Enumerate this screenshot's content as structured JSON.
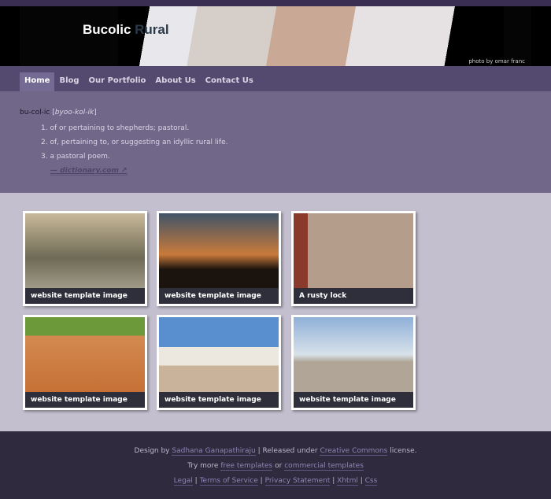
{
  "header": {
    "title_a": "Bucolic",
    "title_b": "Rural",
    "credit": "photo by omar franc"
  },
  "nav": [
    {
      "label": "Home",
      "active": true
    },
    {
      "label": "Blog"
    },
    {
      "label": "Our Portfolio"
    },
    {
      "label": "About Us"
    },
    {
      "label": "Contact Us"
    }
  ],
  "definition": {
    "word": "bu-col-ic",
    "pron": "byoo-kol-ik",
    "senses": [
      "1. of or pertaining to shepherds; pastoral.",
      "2. of, pertaining to, or suggesting an idyllic rural life.",
      "3. a pastoral poem."
    ],
    "source": "— dictionary.com",
    "source_icon": "external-link-icon"
  },
  "gallery": [
    {
      "caption": "website template image",
      "bg": "linear-gradient(180deg,#c9b99a,#6f6a55 60%,#a09a88)"
    },
    {
      "caption": "website template image",
      "bg": "linear-gradient(180deg,#405468,#c97a3a 55%,#1b140e 75%)"
    },
    {
      "caption": "A rusty lock",
      "bg": "linear-gradient(90deg,#8a3a2a 0 12%,#b59d8c 12% 100%)"
    },
    {
      "caption": "website template image",
      "bg": "linear-gradient(180deg,#6c9a3a 0 25%,#d38a4f 25%,#c67036)"
    },
    {
      "caption": "website template image",
      "bg": "linear-gradient(180deg,#5a8fcf 0 40%,#ece8e0 40% 65%,#c9b39a 65%)"
    },
    {
      "caption": "website template image",
      "bg": "linear-gradient(180deg,#8fb0d8,#d8e2ea 50%,#b0a596 60%)"
    }
  ],
  "footer": {
    "design_by": "Design by",
    "designer": "Sadhana Ganapathiraju",
    "released": "| Released under",
    "license_link": "Creative Commons",
    "license_suffix": "license.",
    "try_more": "Try more",
    "free": "free templates",
    "or": "or",
    "commercial": "commercial templates",
    "links": [
      "Legal",
      "Terms of Service",
      "Privacy Statement",
      "Xhtml",
      "Css"
    ],
    "sep": "|"
  }
}
